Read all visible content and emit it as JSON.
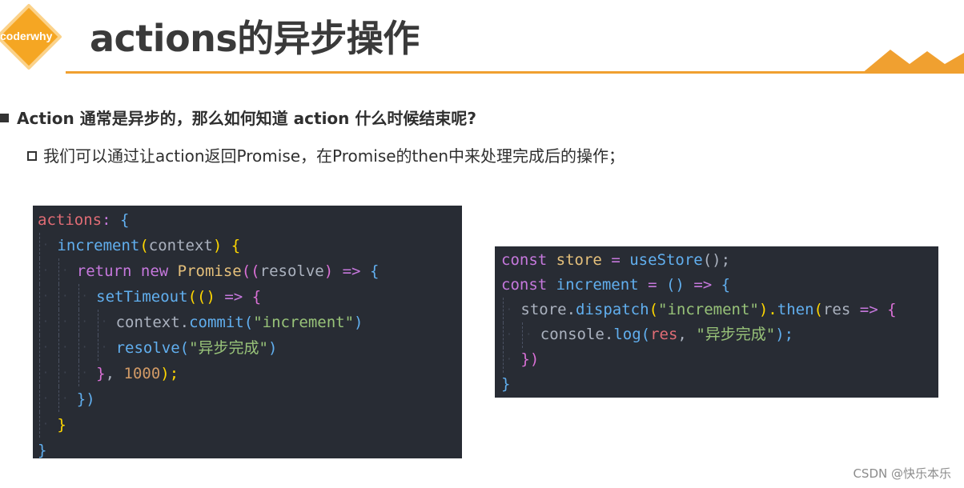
{
  "header": {
    "logo_text": "coderwhy",
    "title": "actions的异步操作",
    "accent_color": "#f0a030"
  },
  "bullets": {
    "level1": "Action 通常是异步的，那么如何知道 action 什么时候结束呢?",
    "level2": "我们可以通过让action返回Promise，在Promise的then中来处理完成后的操作；"
  },
  "code_left": {
    "l1_a": "actions",
    "l1_b": ": ",
    "l1_c": "{",
    "l2_a": "increment",
    "l2_b": "(",
    "l2_c": "context",
    "l2_d": ")",
    "l2_e": " {",
    "l3_a": "return",
    "l3_b": "new",
    "l3_c": "Promise",
    "l3_d": "((",
    "l3_e": "resolve",
    "l3_f": ")",
    "l3_g": "=>",
    "l3_h": "{",
    "l4_a": "setTimeout",
    "l4_b": "(()",
    "l4_c": "=>",
    "l4_d": "{",
    "l5_a": "context",
    "l5_b": ".",
    "l5_c": "commit",
    "l5_d": "(",
    "l5_e": "\"increment\"",
    "l5_f": ")",
    "l6_a": "resolve",
    "l6_b": "(",
    "l6_c": "\"异步完成\"",
    "l6_d": ")",
    "l7_a": "}",
    "l7_b": ", ",
    "l7_c": "1000",
    "l7_d": ");",
    "l8_a": "})",
    "l9_a": "}",
    "l10_a": "}"
  },
  "code_right": {
    "l1_a": "const",
    "l1_b": "store",
    "l1_c": "=",
    "l1_d": "useStore",
    "l1_e": "();",
    "l2_a": "const",
    "l2_b": "increment",
    "l2_c": "=",
    "l2_d": "()",
    "l2_e": "=>",
    "l2_f": "{",
    "l3_a": "store",
    "l3_b": ".",
    "l3_c": "dispatch",
    "l3_d": "(",
    "l3_e": "\"increment\"",
    "l3_f": ").",
    "l3_g": "then",
    "l3_h": "(",
    "l3_i": "res",
    "l3_j": "=>",
    "l3_k": "{",
    "l4_a": "console",
    "l4_b": ".",
    "l4_c": "log",
    "l4_d": "(",
    "l4_e": "res",
    "l4_f": ", ",
    "l4_g": "\"异步完成\"",
    "l4_h": ");",
    "l5_a": "})",
    "l6_a": "}"
  },
  "watermark": "CSDN @快乐本乐"
}
